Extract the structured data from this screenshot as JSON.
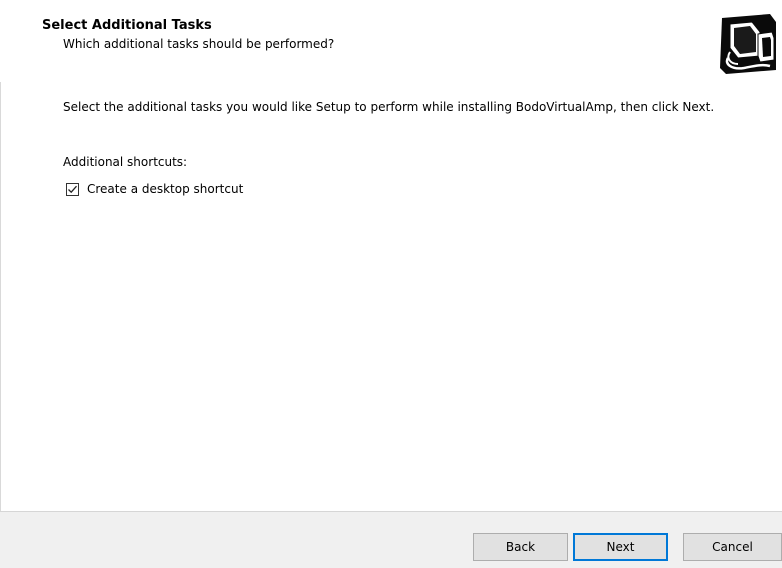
{
  "header": {
    "title": "Select Additional Tasks",
    "subtitle": "Which additional tasks should be performed?",
    "icon": "setup-computer-icon"
  },
  "main": {
    "instruction": "Select the additional tasks you would like Setup to perform while installing BodoVirtualAmp, then click Next.",
    "group_label": "Additional shortcuts:",
    "tasks": [
      {
        "label": "Create a desktop shortcut",
        "checked": true
      }
    ]
  },
  "footer": {
    "back_label": "Back",
    "next_label": "Next",
    "cancel_label": "Cancel"
  },
  "colors": {
    "footer_bg": "#f0f0f0",
    "default_button_border": "#0078d7",
    "button_bg": "#e1e1e1"
  }
}
